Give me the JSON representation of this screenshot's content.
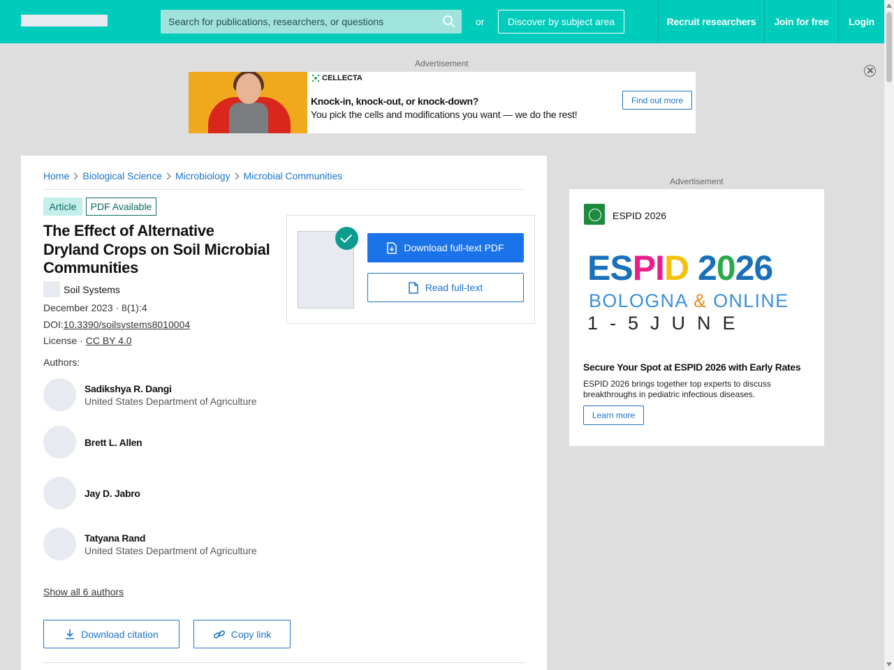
{
  "header": {
    "search_placeholder": "Search for publications, researchers, or questions",
    "or_text": "or",
    "discover_label": "Discover by subject area",
    "nav": [
      "Recruit researchers",
      "Join for free",
      "Login"
    ],
    "brand_color": "#00ccbb"
  },
  "top_ad": {
    "label": "Advertisement",
    "brand": "CELLECTA",
    "headline": "Knock-in, knock-out, or knock-down?",
    "subline": "You pick the cells and modifications you want — we do the rest!",
    "cta": "Find out more"
  },
  "breadcrumb": [
    "Home",
    "Biological Science",
    "Microbiology",
    "Microbial Communities"
  ],
  "badges": {
    "type": "Article",
    "pdf": "PDF Available"
  },
  "article": {
    "title": "The Effect of Alternative Dryland Crops on Soil Microbial Communities",
    "journal": "Soil Systems",
    "date_issue": "December 2023 · 8(1):4",
    "doi_prefix": "DOI:",
    "doi": "10.3390/soilsystems8010004",
    "license_prefix": "License · ",
    "license": "CC BY 4.0"
  },
  "authors_heading": "Authors:",
  "authors": [
    {
      "name": "Sadikshya R. Dangi",
      "affiliation": "United States Department of Agriculture"
    },
    {
      "name": "Brett L. Allen",
      "affiliation": ""
    },
    {
      "name": "Jay D. Jabro",
      "affiliation": ""
    },
    {
      "name": "Tatyana Rand",
      "affiliation": "United States Department of Agriculture"
    }
  ],
  "show_all": "Show all 6 authors",
  "actions": {
    "download_citation": "Download citation",
    "copy_link": "Copy link"
  },
  "pdf_panel": {
    "download": "Download full-text PDF",
    "read": "Read full-text"
  },
  "side_ad": {
    "label": "Advertisement",
    "brand": "ESPID 2026",
    "logo_text": "ESPID",
    "big_1": "ES",
    "big_2": "PI",
    "big_3": "D",
    "big_4": " 2",
    "big_5": "0",
    "big_6": "26",
    "location_1": "BOLOGNA ",
    "location_amp": "&",
    "location_2": " ONLINE",
    "dates": "1-5JUNE",
    "headline": "Secure Your Spot at ESPID 2026 with Early Rates",
    "body": "ESPID 2026 brings together top experts to discuss breakthroughs in pediatric infectious diseases.",
    "cta": "Learn more"
  }
}
